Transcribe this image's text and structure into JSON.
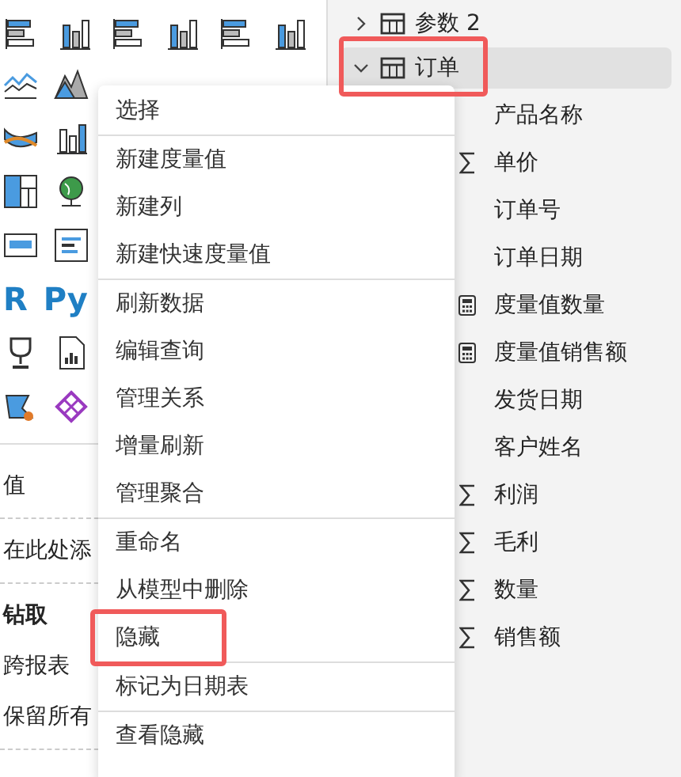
{
  "visual_gallery": {
    "script_labels": [
      "R",
      "Py"
    ]
  },
  "left_panel": {
    "values_label": "值",
    "values_placeholder": "在此处添",
    "drillthrough_title": "钻取",
    "cross_report": "跨报表",
    "keep_filters": "保留所有"
  },
  "fields": [
    {
      "name": "参数 2",
      "expanded": false,
      "selected": false,
      "highlighted": false
    },
    {
      "name": "订单",
      "expanded": true,
      "selected": true,
      "highlighted": true,
      "children": [
        {
          "name": "产品名称",
          "kind": "text"
        },
        {
          "name": "单价",
          "kind": "sum"
        },
        {
          "name": "订单号",
          "kind": "text"
        },
        {
          "name": "订单日期",
          "kind": "text"
        },
        {
          "name": "度量值数量",
          "kind": "measure"
        },
        {
          "name": "度量值销售额",
          "kind": "measure"
        },
        {
          "name": "发货日期",
          "kind": "text"
        },
        {
          "name": "客户姓名",
          "kind": "text"
        },
        {
          "name": "利润",
          "kind": "sum"
        },
        {
          "name": "毛利",
          "kind": "sum"
        },
        {
          "name": "数量",
          "kind": "sum"
        },
        {
          "name": "销售额",
          "kind": "sum"
        }
      ]
    }
  ],
  "context_menu": {
    "groups": [
      [
        {
          "label": "选择",
          "highlighted": false
        }
      ],
      [
        {
          "label": "新建度量值",
          "highlighted": false
        },
        {
          "label": "新建列",
          "highlighted": false
        },
        {
          "label": "新建快速度量值",
          "highlighted": false
        }
      ],
      [
        {
          "label": "刷新数据",
          "highlighted": false
        },
        {
          "label": "编辑查询",
          "highlighted": false
        },
        {
          "label": "管理关系",
          "highlighted": false
        },
        {
          "label": "增量刷新",
          "highlighted": false
        },
        {
          "label": "管理聚合",
          "highlighted": false
        }
      ],
      [
        {
          "label": "重命名",
          "highlighted": false
        },
        {
          "label": "从模型中删除",
          "highlighted": false
        },
        {
          "label": "隐藏",
          "highlighted": true
        }
      ],
      [
        {
          "label": "标记为日期表",
          "highlighted": false
        }
      ],
      [
        {
          "label": "查看隐藏",
          "highlighted": false
        }
      ]
    ]
  }
}
